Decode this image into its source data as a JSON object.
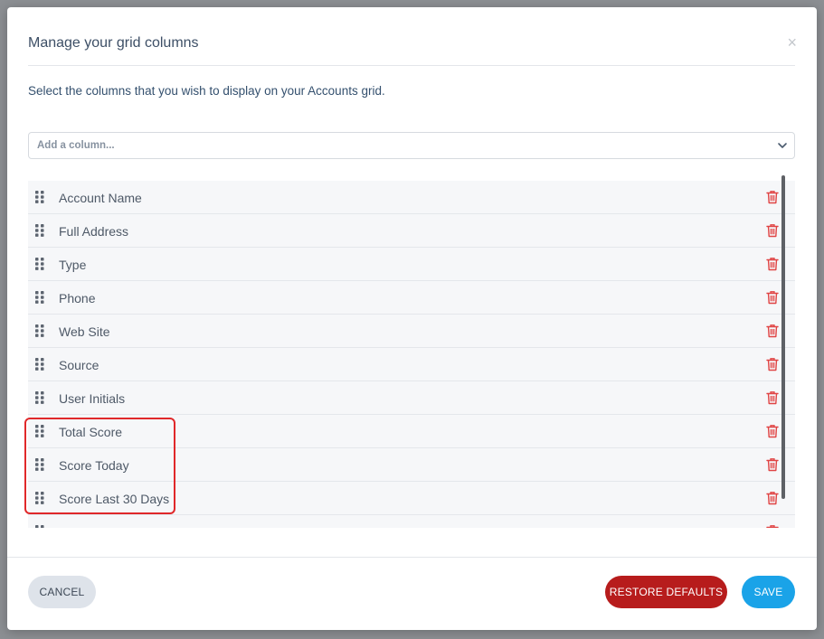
{
  "modal": {
    "title": "Manage your grid columns",
    "close_label": "×",
    "subtitle": "Select the columns that you wish to display on your Accounts grid.",
    "add_column_placeholder": "Add a column...",
    "columns": [
      {
        "label": "Account Name"
      },
      {
        "label": "Full Address"
      },
      {
        "label": "Type"
      },
      {
        "label": "Phone"
      },
      {
        "label": "Web Site"
      },
      {
        "label": "Source"
      },
      {
        "label": "User Initials"
      },
      {
        "label": "Total Score"
      },
      {
        "label": "Score Today"
      },
      {
        "label": "Score Last 30 Days"
      },
      {
        "label": ""
      }
    ],
    "buttons": {
      "cancel": "CANCEL",
      "restore": "RESTORE DEFAULTS",
      "save": "SAVE"
    }
  },
  "colors": {
    "danger": "#b71c1c",
    "primary": "#1aa3e8",
    "highlight": "#e0282a",
    "trash_icon": "#e04444"
  },
  "icons": {
    "drag": "grip-icon",
    "delete": "trash-icon",
    "dropdown": "chevron-down-icon",
    "close": "close-icon"
  }
}
